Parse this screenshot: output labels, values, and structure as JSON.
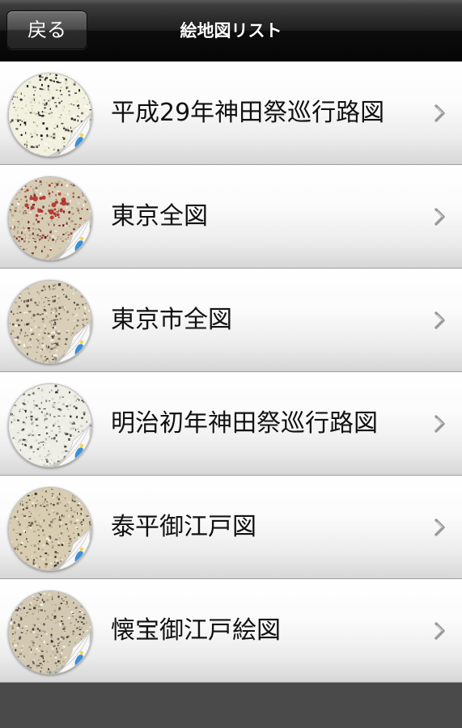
{
  "navbar": {
    "back_label": "戻る",
    "title": "絵地図リスト"
  },
  "list": {
    "items": [
      {
        "label": "平成29年神田祭巡行路図",
        "thumb_icon": "map-thumbnail-icon",
        "thumb_bg": "#f2f0df",
        "thumb_accent": "#c9c6a0",
        "thumb_mark": "#000000",
        "thumb_red": false
      },
      {
        "label": "東京全図",
        "thumb_icon": "map-thumbnail-icon",
        "thumb_bg": "#d6cbb3",
        "thumb_accent": "#a89c82",
        "thumb_mark": "#6a1010",
        "thumb_red": true
      },
      {
        "label": "東京市全図",
        "thumb_icon": "map-thumbnail-icon",
        "thumb_bg": "#d9cfb8",
        "thumb_accent": "#9f947c",
        "thumb_mark": "#3a332a",
        "thumb_red": false
      },
      {
        "label": "明治初年神田祭巡行路図",
        "thumb_icon": "map-thumbnail-icon",
        "thumb_bg": "#eeeee6",
        "thumb_accent": "#b9b9ac",
        "thumb_mark": "#222222",
        "thumb_red": false
      },
      {
        "label": "泰平御江戸図",
        "thumb_icon": "map-thumbnail-icon",
        "thumb_bg": "#d8ccb1",
        "thumb_accent": "#a3957a",
        "thumb_mark": "#3a3024",
        "thumb_red": false
      },
      {
        "label": "懐宝御江戸絵図",
        "thumb_icon": "map-thumbnail-icon",
        "thumb_bg": "#d3c9b2",
        "thumb_accent": "#9a8f78",
        "thumb_mark": "#2e2a23",
        "thumb_red": false
      }
    ]
  },
  "colors": {
    "chevron": "#9a9a9a",
    "page_curl": "#f8f8f8",
    "page_curl_shadow": "#b0b0b0",
    "page_curl_blue": "#3b8fd9",
    "page_curl_yellow": "#f2d64b"
  }
}
